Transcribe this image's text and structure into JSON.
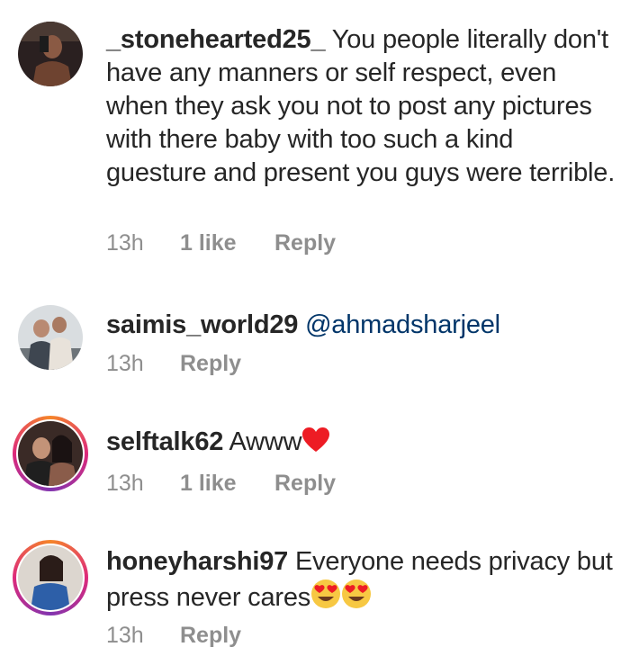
{
  "comments": [
    {
      "username": "_stonehearted25_",
      "text": "You people literally don't have any manners or self respect, even when they ask you not to post any pictures with there baby with too such a kind guesture and present you guys were terrible.",
      "time": "13h",
      "likes": "1 like",
      "reply": "Reply"
    },
    {
      "username": "saimis_world29",
      "text": "@ahmadsharjeel",
      "time": "13h",
      "reply": "Reply"
    },
    {
      "username": "selftalk62",
      "text": "Awww",
      "emoji": "red-heart-icon",
      "time": "13h",
      "likes": "1 like",
      "reply": "Reply"
    },
    {
      "username": "honeyharshi97",
      "text": "Everyone needs privacy but press never cares",
      "emoji": "heart-eyes-icon",
      "time": "13h",
      "reply": "Reply"
    }
  ],
  "colors": {
    "text": "#262626",
    "meta": "#8e8e8e",
    "mention": "#003569",
    "story_ring_start": "#f58529",
    "story_ring_end": "#dd2a7b",
    "heart": "#ed1c24",
    "emoji_face": "#f7c843"
  }
}
